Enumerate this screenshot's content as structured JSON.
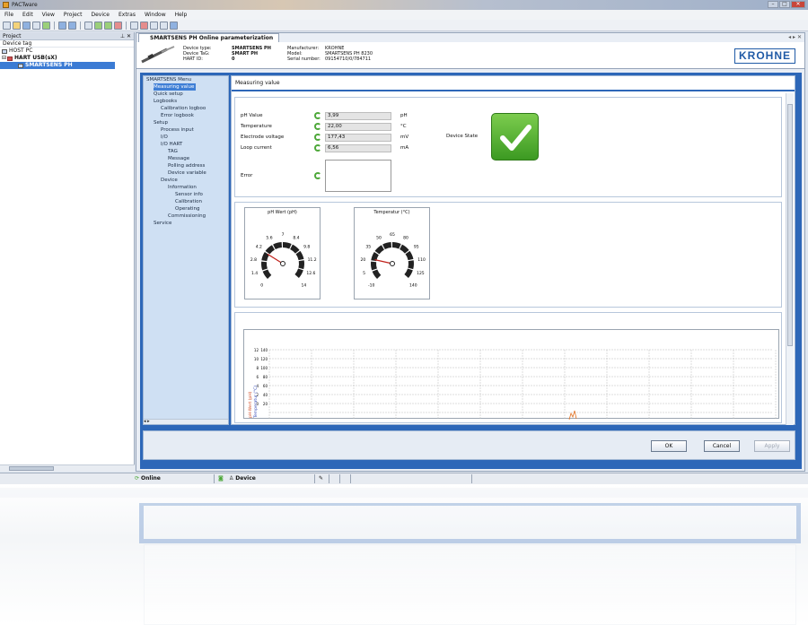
{
  "window": {
    "title": "PACTware"
  },
  "menu": [
    "File",
    "Edit",
    "View",
    "Project",
    "Device",
    "Extras",
    "Window",
    "Help"
  ],
  "project": {
    "panel_title": "Project",
    "column": "Device tag",
    "tree": [
      {
        "label": "HOST PC",
        "level": 0
      },
      {
        "label": "HART USB(sX)",
        "level": 1
      },
      {
        "label": "SMARTSENS PH",
        "level": 2,
        "selected": true
      }
    ]
  },
  "doc": {
    "tab": "SMARTSENS PH Online parameterization",
    "header": {
      "labels_left": [
        "Device type:",
        "Device TaG:",
        "HART ID:"
      ],
      "values_left": [
        "SMARTSENS PH",
        "SMART PH",
        "0"
      ],
      "labels_right": [
        "Manufacturer:",
        "Model:",
        "Serial number:"
      ],
      "values_right": [
        "KROHNE",
        "SMARTSENS PH 8230",
        "09154710/0/784711"
      ],
      "brand": "KROHNE"
    }
  },
  "menu_tree": [
    {
      "label": "SMARTSENS Menu",
      "indent": 0
    },
    {
      "label": "Measuring value",
      "indent": 1,
      "selected": true
    },
    {
      "label": "Quick setup",
      "indent": 1
    },
    {
      "label": "Logbooks",
      "indent": 1
    },
    {
      "label": "Calibration logboo",
      "indent": 2
    },
    {
      "label": "Error logbook",
      "indent": 2
    },
    {
      "label": "Setup",
      "indent": 1
    },
    {
      "label": "Process input",
      "indent": 2
    },
    {
      "label": "I/O",
      "indent": 2
    },
    {
      "label": "I/O HART",
      "indent": 2
    },
    {
      "label": "TAG",
      "indent": 3
    },
    {
      "label": "Message",
      "indent": 3
    },
    {
      "label": "Polling address",
      "indent": 3
    },
    {
      "label": "Device variable",
      "indent": 3
    },
    {
      "label": "Device",
      "indent": 2
    },
    {
      "label": "Information",
      "indent": 3
    },
    {
      "label": "Sensor info",
      "indent": 4
    },
    {
      "label": "Calibration",
      "indent": 4
    },
    {
      "label": "Operating",
      "indent": 4
    },
    {
      "label": "Commissioning",
      "indent": 3
    },
    {
      "label": "Service",
      "indent": 1
    }
  ],
  "content": {
    "title": "Measuring value",
    "values": [
      {
        "label": "pH Value",
        "value": "3,99",
        "unit": "pH"
      },
      {
        "label": "Temperature",
        "value": "22,00",
        "unit": "°C"
      },
      {
        "label": "Electrode voltage",
        "value": "177,43",
        "unit": "mV"
      },
      {
        "label": "Loop current",
        "value": "6,56",
        "unit": "mA"
      }
    ],
    "error_label": "Error",
    "device_state_label": "Device State",
    "device_state_color": "#4caf2f"
  },
  "gauges": [
    {
      "title": "pH Wert (pH)",
      "min": 0,
      "max": 14,
      "value": 3.99,
      "ticks": [
        "0",
        "1.4",
        "2.8",
        "4.2",
        "5.6",
        "7",
        "8.4",
        "9.8",
        "11.2",
        "12.6",
        "14"
      ]
    },
    {
      "title": "Temperatur (°C)",
      "min": -10,
      "max": 140,
      "value": 22,
      "ticks": [
        "-10",
        "5",
        "20",
        "35",
        "50",
        "65",
        "80",
        "95",
        "110",
        "125",
        "140"
      ]
    }
  ],
  "trend": {
    "y_labels": [
      "pH-Wert (pH)",
      "Temperatur (°C)"
    ],
    "y_ticks": [
      "12",
      "10",
      "8",
      "6",
      "4",
      "2",
      "0"
    ],
    "y2_ticks": [
      "140",
      "120",
      "100",
      "80",
      "60",
      "40",
      "20"
    ]
  },
  "buttons": {
    "ok": "OK",
    "cancel": "Cancel",
    "apply": "Apply"
  },
  "status": {
    "online": "Online",
    "device": "Device"
  }
}
